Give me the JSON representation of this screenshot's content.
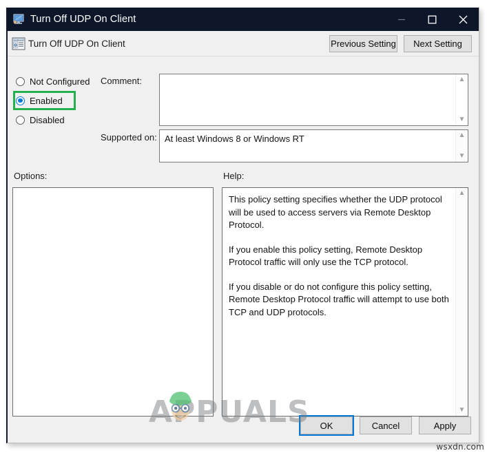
{
  "window": {
    "title": "Turn Off UDP On Client",
    "title_icon": "monitor-icon",
    "controls": {
      "minimize": "minimize-icon",
      "maximize": "maximize-icon",
      "close": "close-icon"
    }
  },
  "toolbar": {
    "policy_icon": "group-policy-setting-icon",
    "setting_name": "Turn Off UDP On Client",
    "previous_setting_label": "Previous Setting",
    "next_setting_label": "Next Setting"
  },
  "state_options": {
    "items": [
      {
        "label": "Not Configured",
        "selected": false,
        "highlighted": false
      },
      {
        "label": "Enabled",
        "selected": true,
        "highlighted": true
      },
      {
        "label": "Disabled",
        "selected": false,
        "highlighted": false
      }
    ],
    "highlight_color": "#22b14c",
    "selected_color": "#0078d7"
  },
  "comment": {
    "label": "Comment:",
    "value": "",
    "placeholder": ""
  },
  "supported_on": {
    "label": "Supported on:",
    "value": "At least Windows 8 or Windows RT"
  },
  "options": {
    "label": "Options:",
    "value": ""
  },
  "help": {
    "label": "Help:",
    "paragraphs": [
      "This policy setting specifies whether the UDP protocol will be used to access servers via Remote Desktop Protocol.",
      "If you enable this policy setting, Remote Desktop Protocol traffic will only use the TCP protocol.",
      "If you disable or do not configure this policy setting, Remote Desktop Protocol traffic will attempt to use both TCP and UDP protocols."
    ]
  },
  "footer": {
    "ok_label": "OK",
    "cancel_label": "Cancel",
    "apply_label": "Apply",
    "default_button": "OK"
  },
  "watermarks": {
    "center": "APPUALS",
    "corner": "wsxdn.com"
  },
  "scroll": {
    "up_arrow": "chevron-up-icon",
    "down_arrow": "chevron-down-icon"
  }
}
